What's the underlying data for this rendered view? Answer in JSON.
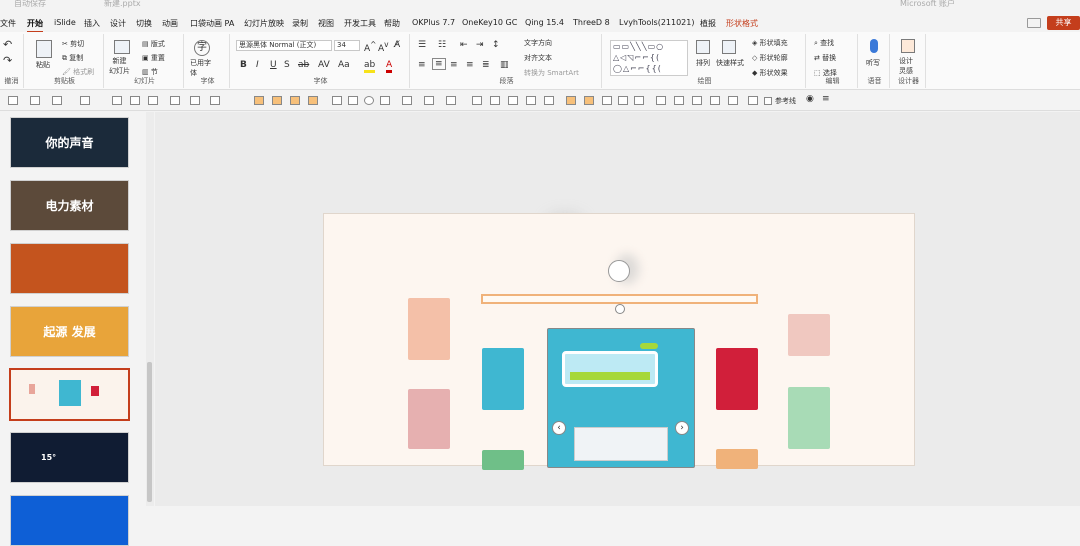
{
  "titlebar": {
    "autosave": "自动保存",
    "filename": "新建.pptx",
    "account": "Microsoft 账户"
  },
  "menu": {
    "tabs": [
      "文件",
      "开始",
      "iSlide",
      "插入",
      "设计",
      "切换",
      "动画",
      "口袋动画 PA",
      "幻灯片放映",
      "录制",
      "视图",
      "开发工具",
      "帮助",
      "OKPlus 7.7",
      "OneKey10 GC",
      "Qing 15.4",
      "ThreeD 8",
      "LvyhTools(211021)",
      "植报",
      "形状格式"
    ],
    "share": "共享"
  },
  "ribbon": {
    "groups": [
      "撤消",
      "剪贴板",
      "幻灯片",
      "字体",
      "字体",
      "段落",
      "绘图",
      "编辑",
      "语音",
      "设计器"
    ],
    "clipboard": {
      "paste": "粘贴",
      "cut": "剪切",
      "copy": "复制",
      "format": "格式刷"
    },
    "slides": {
      "new": "新建\n幻灯片",
      "layout": "版式",
      "reset": "重置",
      "section": "节"
    },
    "font_tools": {
      "used_font": "已用字\n体"
    },
    "font": {
      "name": "思源黑体 Normal (正文)",
      "size": "34"
    },
    "paragraph": {
      "text_dir": "文字方向",
      "align_text": "对齐文本",
      "smartart": "转换为 SmartArt"
    },
    "drawing": {
      "arrange": "排列",
      "quick_style": "快速样式",
      "fill": "形状填充",
      "outline": "形状轮廓",
      "effect": "形状效果"
    },
    "editing": {
      "find": "查找",
      "replace": "替换",
      "select": "选择"
    },
    "voice": {
      "dictate": "听写"
    },
    "designer": {
      "idea": "设计\n灵感"
    }
  },
  "qat": {
    "guides": "参考线"
  },
  "slides": [
    {
      "num": "",
      "text": "你的声音",
      "bg": "#1b2a3a"
    },
    {
      "num": "",
      "text": "电力素材",
      "bg": "#5c4a3a"
    },
    {
      "num": "",
      "text": "",
      "bg": "#c4541e"
    },
    {
      "num": "",
      "text": "起源 发展",
      "bg": "#e8a43a"
    },
    {
      "num": "",
      "text": "",
      "bg": "#fbf3ec",
      "selected": true
    },
    {
      "num": "",
      "text": "15°",
      "bg": "#101c33"
    },
    {
      "num": "",
      "text": "",
      "bg": "#0e5fd6"
    }
  ],
  "colors": {
    "accent": "#c43e1c",
    "teal": "#3fb7d1",
    "red": "#d11f3a",
    "green": "#6fbf88",
    "pink": "#e8a59a",
    "orange": "#f0b27a"
  }
}
